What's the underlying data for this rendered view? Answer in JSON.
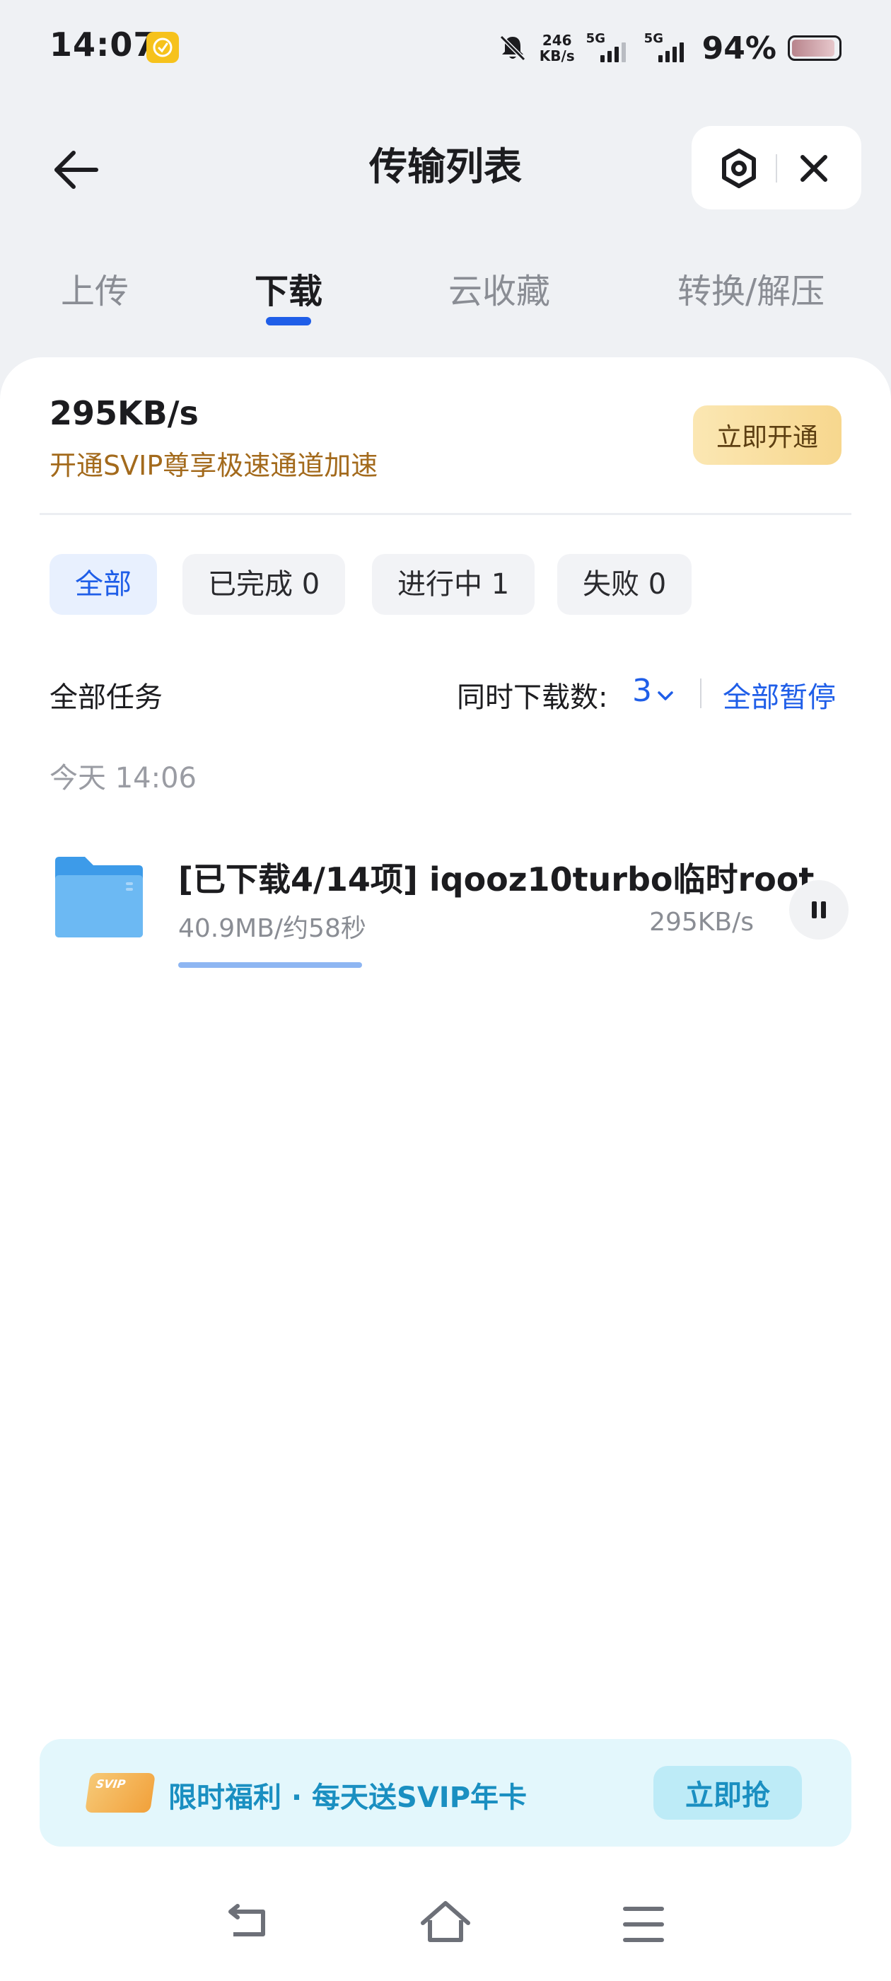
{
  "status_bar": {
    "time": "14:07",
    "net_speed_value": "246",
    "net_speed_unit": "KB/s",
    "sim1_label": "5G",
    "sim2_label": "5G",
    "battery_percent": "94%",
    "battery_level": 0.94
  },
  "header": {
    "title": "传输列表"
  },
  "tabs": [
    {
      "label": "上传",
      "active": false
    },
    {
      "label": "下载",
      "active": true
    },
    {
      "label": "云收藏",
      "active": false
    },
    {
      "label": "转换/解压",
      "active": false
    }
  ],
  "speed_panel": {
    "speed": "295KB/s",
    "promo": "开通SVIP尊享极速通道加速",
    "open_button": "立即开通"
  },
  "filters": [
    {
      "label": "全部",
      "active": true
    },
    {
      "label": "已完成 0",
      "active": false
    },
    {
      "label": "进行中 1",
      "active": false
    },
    {
      "label": "失败 0",
      "active": false
    }
  ],
  "task_header": {
    "all_tasks": "全部任务",
    "concurrent_label": "同时下载数:",
    "concurrent_value": "3",
    "pause_all": "全部暂停"
  },
  "date_group": "今天 14:06",
  "tasks": [
    {
      "title": "[已下载4/14项] iqooz10turbo临时root",
      "size_eta": "40.9MB/约58秒",
      "speed": "295KB/s",
      "progress": 0.32,
      "state_icon": "pause-icon"
    }
  ],
  "promo_banner": {
    "badge": "SVIP",
    "text": "限时福利 · 每天送SVIP年卡",
    "button": "立即抢"
  },
  "colors": {
    "accent": "#1f5ee8",
    "promo_orange": "#a36a1c",
    "banner_blue": "#1a8fc1",
    "background": "#eff1f4"
  }
}
